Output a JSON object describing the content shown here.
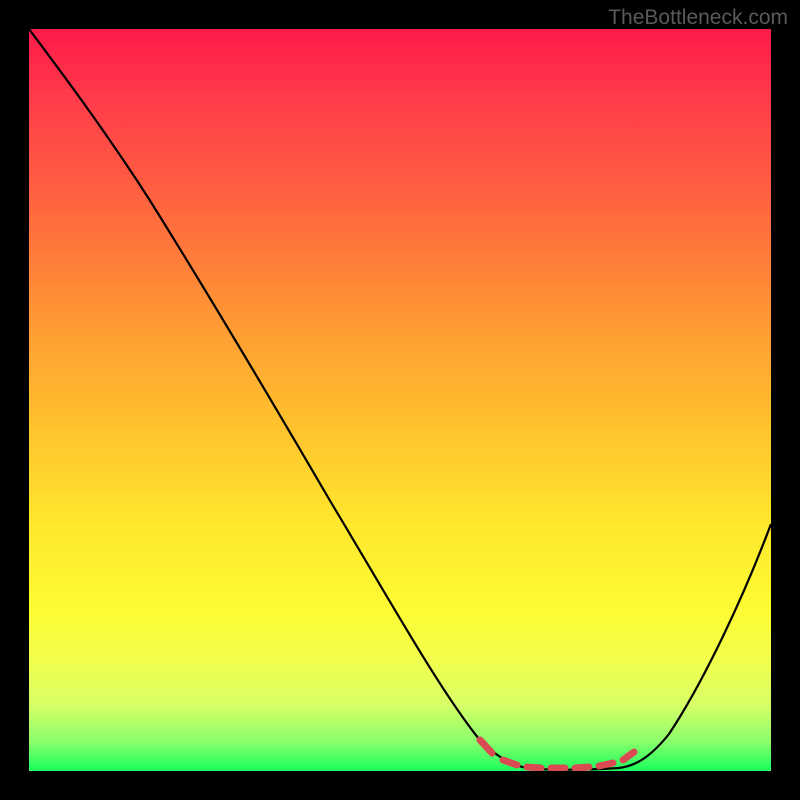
{
  "attribution": "TheBottleneck.com",
  "chart_data": {
    "type": "line",
    "title": "",
    "xlabel": "",
    "ylabel": "",
    "xlim": [
      0,
      100
    ],
    "ylim": [
      0,
      100
    ],
    "series": [
      {
        "name": "bottleneck-curve",
        "x": [
          0,
          5,
          10,
          15,
          20,
          25,
          30,
          35,
          40,
          45,
          50,
          55,
          60,
          62,
          65,
          68,
          72,
          76,
          80,
          82,
          85,
          90,
          95,
          100
        ],
        "y": [
          100,
          94,
          88,
          81,
          73,
          66,
          58,
          50,
          42,
          33,
          24,
          15,
          7,
          4,
          2,
          1,
          0.5,
          0.5,
          1,
          2,
          5,
          12,
          22,
          33
        ]
      },
      {
        "name": "optimal-zone-markers",
        "x": [
          62,
          65,
          67,
          69,
          71,
          73,
          75,
          77,
          79,
          81
        ],
        "y": [
          3.5,
          2,
          1.4,
          1,
          0.8,
          0.8,
          1,
          1.4,
          2,
          3.5
        ]
      }
    ],
    "gradient_stops": [
      {
        "pos": 0,
        "color": "#ff1a4a"
      },
      {
        "pos": 0.1,
        "color": "#ff3d4a"
      },
      {
        "pos": 0.22,
        "color": "#ff6040"
      },
      {
        "pos": 0.33,
        "color": "#ff8438"
      },
      {
        "pos": 0.44,
        "color": "#ffa731"
      },
      {
        "pos": 0.56,
        "color": "#ffc92d"
      },
      {
        "pos": 0.67,
        "color": "#ffe82d"
      },
      {
        "pos": 0.78,
        "color": "#fdfb33"
      },
      {
        "pos": 0.85,
        "color": "#f2ff4d"
      },
      {
        "pos": 0.91,
        "color": "#d8ff66"
      },
      {
        "pos": 0.96,
        "color": "#8aff6b"
      },
      {
        "pos": 1.0,
        "color": "#1aff5e"
      }
    ]
  }
}
